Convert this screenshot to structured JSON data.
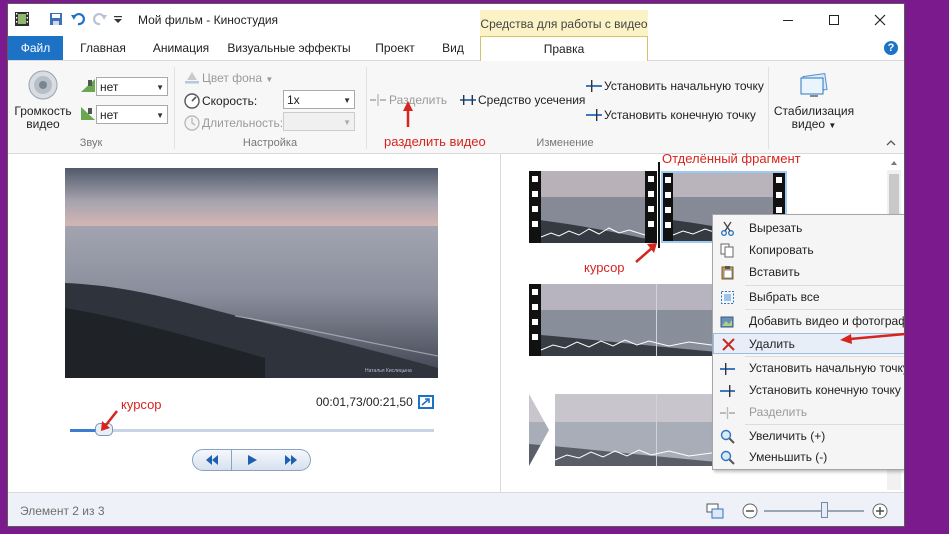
{
  "window": {
    "title": "Мой фильм - Киностудия",
    "context_tab_header": "Средства для работы с видео",
    "help": "?"
  },
  "tabs": [
    {
      "label": "Файл"
    },
    {
      "label": "Главная"
    },
    {
      "label": "Анимация"
    },
    {
      "label": "Визуальные эффекты"
    },
    {
      "label": "Проект"
    },
    {
      "label": "Вид"
    },
    {
      "label": "Правка"
    }
  ],
  "ribbon": {
    "sound": {
      "volume_label": "Громкость видео",
      "fade_in_value": "нет",
      "fade_out_value": "нет",
      "group_label": "Звук"
    },
    "settings": {
      "bg_color_label": "Цвет фона",
      "speed_label": "Скорость:",
      "speed_value": "1x",
      "duration_label": "Длительность:",
      "duration_value": "",
      "group_label": "Настройка"
    },
    "edit": {
      "split_label": "Разделить",
      "trim_label": "Средство усечения",
      "set_start_label": "Установить начальную точку",
      "set_end_label": "Установить конечную точку",
      "group_label": "Изменение"
    },
    "stabilize": {
      "label": "Стабилизация видео"
    }
  },
  "preview": {
    "timecode": "00:01,73/00:21,50",
    "watermark": "Наталья Кислицына",
    "playhead_fraction": 0.09
  },
  "context_menu": {
    "items": [
      {
        "label": "Вырезать",
        "icon": "scissors-icon",
        "enabled": true
      },
      {
        "label": "Копировать",
        "icon": "copy-icon",
        "enabled": true
      },
      {
        "label": "Вставить",
        "icon": "paste-icon",
        "enabled": true
      },
      {
        "label": "Выбрать все",
        "icon": "select-all-icon",
        "enabled": true
      },
      {
        "label": "Добавить видео и фотографии",
        "icon": "add-media-icon",
        "enabled": true
      },
      {
        "label": "Удалить",
        "icon": "delete-icon",
        "enabled": true,
        "highlighted": true
      },
      {
        "label": "Установить начальную точку",
        "icon": "set-start-icon",
        "enabled": true
      },
      {
        "label": "Установить конечную точку",
        "icon": "set-end-icon",
        "enabled": true
      },
      {
        "label": "Разделить",
        "icon": "split-icon",
        "enabled": false
      },
      {
        "label": "Увеличить (+)",
        "icon": "zoom-in-icon",
        "enabled": true
      },
      {
        "label": "Уменьшить (-)",
        "icon": "zoom-out-icon",
        "enabled": true
      }
    ]
  },
  "status": {
    "text": "Элемент 2 из 3",
    "zoom_fraction": 0.6
  },
  "annotations": {
    "split_video": "разделить видео",
    "separated_fragment": "Отделённый фрагмент",
    "cursor_storyboard": "курсор",
    "cursor_preview": "курсор"
  },
  "colors": {
    "accent": "#1e72c6",
    "context_tab": "#fbf3c5",
    "annotation": "#d6241f",
    "frame_background": "#7a1a8c"
  }
}
